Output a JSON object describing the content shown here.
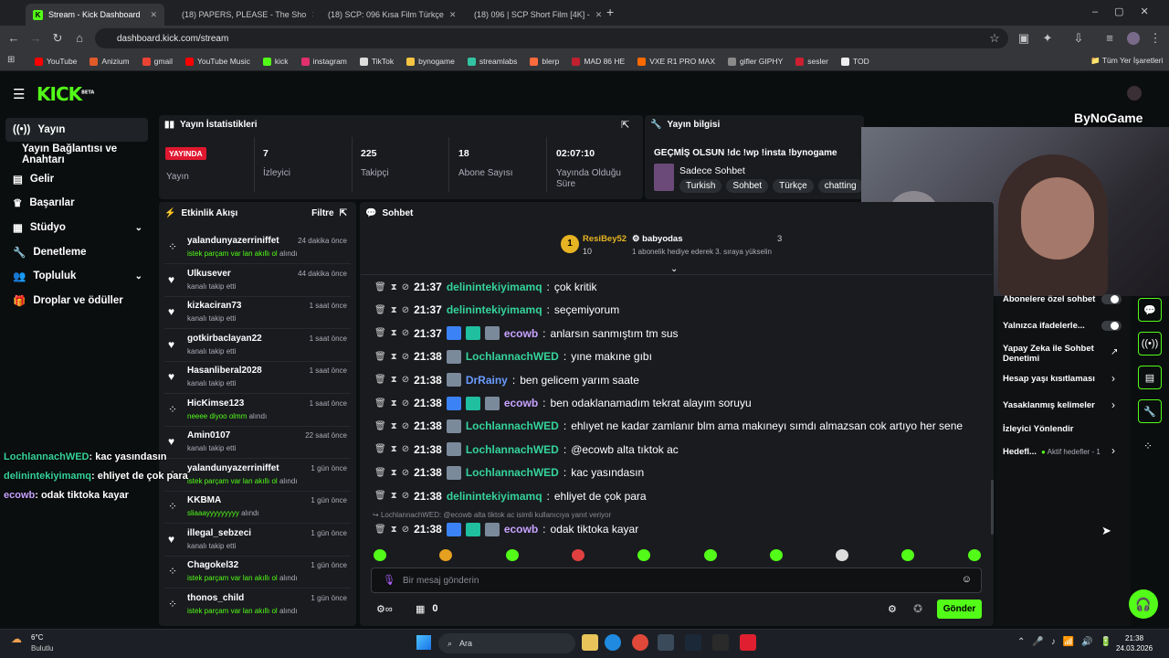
{
  "browser": {
    "tabs": [
      {
        "title": "Stream - Kick Dashboard",
        "icon": "kick-favicon",
        "active": true
      },
      {
        "title": "(18) PAPERS, PLEASE - The Sho",
        "icon": "youtube-favicon"
      },
      {
        "title": "(18) SCP: 096 Kısa Film Türkçe",
        "icon": "youtube-favicon"
      },
      {
        "title": "(18) 096 | SCP Short Film [4K] -",
        "icon": "youtube-favicon"
      }
    ],
    "url": "dashboard.kick.com/stream",
    "bookmarks": [
      "YouTube",
      "Anizium",
      "gmail",
      "YouTube Music",
      "kick",
      "instagram",
      "TikTok",
      "bynogame",
      "streamlabs",
      "blerp",
      "MAD 86 HE",
      "VXE R1 PRO MAX",
      "gifler GIPHY",
      "sesler",
      "TOD"
    ],
    "all_bookmarks": "Tüm Yer İşaretleri"
  },
  "kick": {
    "logo": "KICK",
    "logo_sup": "BETA"
  },
  "sidebar": [
    {
      "label": "Yayın",
      "icon": "broadcast-icon",
      "active": true
    },
    {
      "label": "Yayın Bağlantısı ve Anahtarı",
      "icon": "",
      "sub": true
    },
    {
      "label": "Gelir",
      "icon": "money-icon"
    },
    {
      "label": "Başarılar",
      "icon": "trophy-icon"
    },
    {
      "label": "Stüdyo",
      "icon": "studio-icon",
      "chevron": true
    },
    {
      "label": "Denetleme",
      "icon": "wrench-icon"
    },
    {
      "label": "Topluluk",
      "icon": "people-icon",
      "chevron": true
    },
    {
      "label": "Droplar ve ödüller",
      "icon": "gift-icon"
    }
  ],
  "stats": {
    "title": "Yayın İstatistikleri",
    "live": "YAYINDA",
    "live_label": "Yayın",
    "items": [
      {
        "value": "7",
        "label": "İzleyici"
      },
      {
        "value": "225",
        "label": "Takipçi"
      },
      {
        "value": "18",
        "label": "Abone Sayısı"
      },
      {
        "value": "02:07:10",
        "label": "Yayında Olduğu Süre"
      }
    ]
  },
  "info": {
    "title": "Yayın bilgisi",
    "stream_title": "GEÇMİŞ OLSUN !dc !wp !insta !bynogame",
    "category": "Sadece Sohbet",
    "tags": [
      "Turkish",
      "Sohbet",
      "Türkçe",
      "chatting"
    ]
  },
  "webcam": {
    "watermark": "ByNoGame"
  },
  "activity": {
    "title": "Etkinlik Akışı",
    "filter": "Filtre",
    "items": [
      {
        "name": "yalandunyazerriniffet",
        "sub": "istek parçam var lan akıllı ol",
        "sub2": "alındı",
        "time": "24 dakika önce",
        "type": "reward"
      },
      {
        "name": "Ulkusever",
        "sub": "kanalı takip etti",
        "time": "44 dakika önce",
        "type": "follow"
      },
      {
        "name": "kizkaciran73",
        "sub": "kanalı takip etti",
        "time": "1 saat önce",
        "type": "follow"
      },
      {
        "name": "gotkirbaclayan22",
        "sub": "kanalı takip etti",
        "time": "1 saat önce",
        "type": "follow"
      },
      {
        "name": "Hasanliberal2028",
        "sub": "kanalı takip etti",
        "time": "1 saat önce",
        "type": "follow"
      },
      {
        "name": "HicKimse123",
        "sub": "neeee diyoo olmm",
        "sub2": "alındı",
        "time": "1 saat önce",
        "type": "reward"
      },
      {
        "name": "Amin0107",
        "sub": "kanalı takip etti",
        "time": "22 saat önce",
        "type": "follow"
      },
      {
        "name": "yalandunyazerriniffet",
        "sub": "istek parçam var lan akıllı ol",
        "sub2": "alındı",
        "time": "1 gün önce",
        "type": "reward"
      },
      {
        "name": "KKBMA",
        "sub": "sliaaayyyyyyyyy",
        "sub2": "alındı",
        "time": "1 gün önce",
        "type": "reward"
      },
      {
        "name": "illegal_sebzeci",
        "sub": "kanalı takip etti",
        "time": "1 gün önce",
        "type": "follow"
      },
      {
        "name": "Chagokel32",
        "sub": "istek parçam var lan akıllı ol",
        "sub2": "alındı",
        "time": "1 gün önce",
        "type": "reward"
      },
      {
        "name": "thonos_child",
        "sub": "istek parçam var lan akıllı ol",
        "sub2": "alındı",
        "time": "1 gün önce",
        "type": "reward"
      }
    ]
  },
  "chat": {
    "title": "Sohbet",
    "pinned": {
      "rank": "1",
      "user": "ResiBey52",
      "count": "10",
      "user2": "babyodas",
      "count2": "3",
      "note": "1 abonelik hediye ederek 3. sıraya yükselin"
    },
    "messages": [
      {
        "time": "21:37",
        "user": "delinintekiyimamq",
        "color": "#35d39a",
        "text": "çok kritik",
        "badges": 0
      },
      {
        "time": "21:37",
        "user": "delinintekiyimamq",
        "color": "#35d39a",
        "text": "seçemiyorum",
        "badges": 0
      },
      {
        "time": "21:37",
        "user": "ecowb",
        "color": "#c8a2ff",
        "text": "anlarsın sanmıştım tm sus",
        "badges": 3
      },
      {
        "time": "21:38",
        "user": "LochlannachWED",
        "color": "#35d39a",
        "text": "yıne makıne gıbı",
        "badges": 1
      },
      {
        "time": "21:38",
        "user": "DrRainy",
        "color": "#6b9bff",
        "text": "ben gelicem yarım saate",
        "badges": 1
      },
      {
        "time": "21:38",
        "user": "ecowb",
        "color": "#c8a2ff",
        "text": "ben odaklanamadım tekrat alayım soruyu",
        "badges": 3
      },
      {
        "time": "21:38",
        "user": "LochlannachWED",
        "color": "#35d39a",
        "text": "ehlıyet ne kadar zamlanır blm ama makıneyı sımdı almazsan cok artıyo her sene",
        "badges": 1
      },
      {
        "time": "21:38",
        "user": "LochlannachWED",
        "color": "#35d39a",
        "text": "@ecowb alta tıktok ac",
        "badges": 1
      },
      {
        "time": "21:38",
        "user": "LochlannachWED",
        "color": "#35d39a",
        "text": "kac yasındasın",
        "badges": 1
      },
      {
        "time": "21:38",
        "user": "delinintekiyimamq",
        "color": "#35d39a",
        "text": "ehliyet de çok para",
        "badges": 0
      }
    ],
    "reply_note": "LochlannachWED: @ecowb alta tiktok ac isimli kullanıcıya yanıt veriyor",
    "reply_msg": {
      "time": "21:38",
      "user": "ecowb",
      "color": "#c8a2ff",
      "text": "odak tiktoka kayar"
    },
    "input_placeholder": "Bir mesaj gönderin",
    "points": "0",
    "send": "Gönder"
  },
  "settings": [
    {
      "label": "Abonelere özel sohbet",
      "type": "toggle"
    },
    {
      "label": "Yalnızca ifadelerle...",
      "type": "toggle"
    },
    {
      "label": "Yapay Zeka ile Sohbet Denetimi",
      "type": "external"
    },
    {
      "label": "Hesap yaşı kısıtlaması",
      "type": "chevron"
    },
    {
      "label": "Yasaklanmış kelimeler",
      "type": "chevron"
    },
    {
      "label": "İzleyici Yönlendir",
      "type": "none"
    },
    {
      "label": "Hedefl...",
      "extra": "Aktif hedefler - 1",
      "type": "chevron"
    }
  ],
  "overlay": [
    {
      "user": "LochlannachWED",
      "color": "#35d39a",
      "text": ": kac yasındasın"
    },
    {
      "user": "delinintekiyimamq",
      "color": "#35d39a",
      "text": ": ehliyet de çok para"
    },
    {
      "user": "ecowb",
      "color": "#c8a2ff",
      "text": ": odak tiktoka kayar"
    }
  ],
  "taskbar": {
    "weather_temp": "6°C",
    "weather_desc": "Bulutlu",
    "search": "Ara",
    "time": "21:38",
    "date": "24.03.2026"
  }
}
